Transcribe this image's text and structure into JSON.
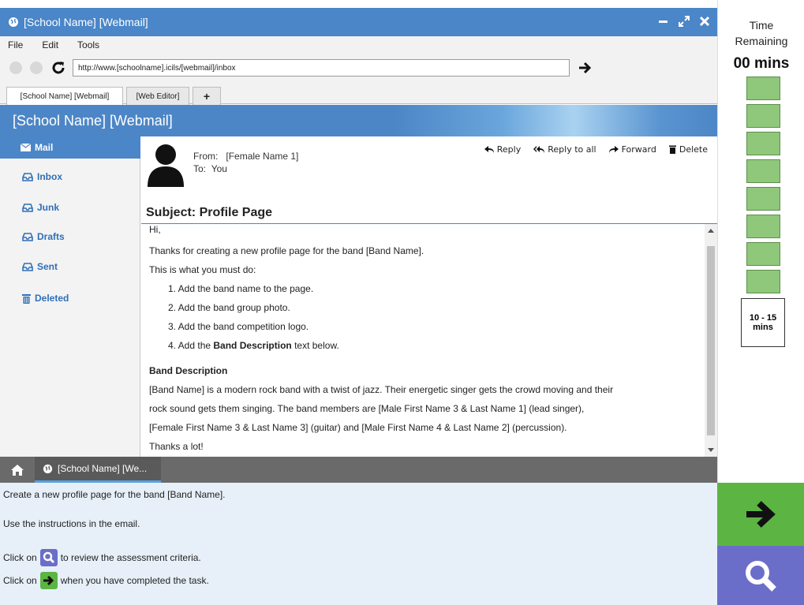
{
  "window": {
    "title": "[School Name] [Webmail]"
  },
  "menu": {
    "file": "File",
    "edit": "Edit",
    "tools": "Tools"
  },
  "address": {
    "url": "http://www.[schoolname].icils/[webmail]/inbox"
  },
  "tabs": [
    {
      "label": "[School Name] [Webmail]",
      "active": true
    },
    {
      "label": "[Web Editor]",
      "active": false
    },
    {
      "label": "+",
      "active": false
    }
  ],
  "banner": {
    "title": "[School Name] [Webmail]"
  },
  "sidebar": {
    "items": [
      {
        "label": "Mail",
        "icon": "envelope-icon"
      },
      {
        "label": "Inbox",
        "icon": "inbox-icon"
      },
      {
        "label": "Junk",
        "icon": "inbox-icon"
      },
      {
        "label": "Drafts",
        "icon": "inbox-icon"
      },
      {
        "label": "Sent",
        "icon": "inbox-icon"
      },
      {
        "label": "Deleted",
        "icon": "trash-icon"
      }
    ]
  },
  "email": {
    "from_label": "From:",
    "from": "[Female Name 1]",
    "to_label": "To:",
    "to": "You",
    "actions": {
      "reply": "Reply",
      "reply_all": "Reply to all",
      "forward": "Forward",
      "delete": "Delete"
    },
    "subject": "Subject: Profile Page",
    "body": {
      "greeting": "Hi,",
      "line1": "Thanks for creating a new profile page for the band [Band Name].",
      "line2": "This is what you must do:",
      "steps": [
        "1. Add the band name to the page.",
        "2. Add the band group photo.",
        "3. Add the band competition logo.",
        "4. Add the "
      ],
      "step4_bold": "Band Description",
      "step4_tail": " text below.",
      "heading": "Band Description",
      "desc1": "[Band Name] is a modern rock band with a twist of jazz. Their energetic singer gets the crowd moving and their",
      "desc2": "rock sound gets them singing. The band members are [Male First Name 3 & Last Name 1] (lead singer),",
      "desc3": "[Female First Name 3 & Last Name 3] (guitar) and [Male First Name 4 & Last Name 2] (percussion).",
      "signoff": "Thanks a lot!"
    }
  },
  "taskbar": {
    "tab": "[School Name] [We..."
  },
  "instructions": {
    "line1": "Create a new profile page for the band [Band Name].",
    "line2": "Use the instructions in the email.",
    "line3_pre": "Click on",
    "line3_post": "to review the assessment criteria.",
    "line4_pre": "Click on",
    "line4_post": "when you have completed the task."
  },
  "timer": {
    "label_line1": "Time",
    "label_line2": "Remaining",
    "value": "00 mins",
    "range_line1": "10 - 15",
    "range_line2": "mins"
  },
  "colors": {
    "brand_blue": "#4a86c8",
    "next_green": "#5cb543",
    "review_purple": "#6b6ec8",
    "timer_block": "#8fc87b"
  }
}
